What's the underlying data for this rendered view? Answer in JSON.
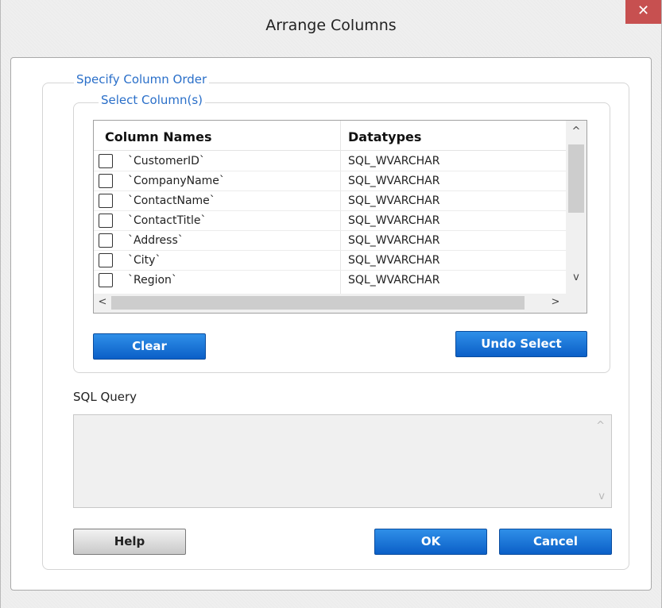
{
  "window": {
    "title": "Arrange Columns",
    "close_glyph": "✕"
  },
  "groups": {
    "outer_legend": "Specify Column Order",
    "inner_legend": "Select Column(s)"
  },
  "grid": {
    "headers": [
      "Column Names",
      "Datatypes"
    ],
    "rows": [
      {
        "name": "`CustomerID`",
        "type": "SQL_WVARCHAR",
        "checked": false
      },
      {
        "name": "`CompanyName`",
        "type": "SQL_WVARCHAR",
        "checked": false
      },
      {
        "name": "`ContactName`",
        "type": "SQL_WVARCHAR",
        "checked": false
      },
      {
        "name": "`ContactTitle`",
        "type": "SQL_WVARCHAR",
        "checked": false
      },
      {
        "name": "`Address`",
        "type": "SQL_WVARCHAR",
        "checked": false
      },
      {
        "name": "`City`",
        "type": "SQL_WVARCHAR",
        "checked": false
      },
      {
        "name": "`Region`",
        "type": "SQL_WVARCHAR",
        "checked": false
      }
    ],
    "arrows": {
      "up": "^",
      "down": "v",
      "left": "<",
      "right": ">"
    }
  },
  "buttons": {
    "clear": "Clear",
    "undo_select": "Undo Select",
    "help": "Help",
    "ok": "OK",
    "cancel": "Cancel"
  },
  "sql": {
    "label": "SQL Query",
    "value": ""
  },
  "colors": {
    "accent_blue": "#0b5fc7",
    "legend_blue": "#2a6fc9",
    "close_red": "#c75050"
  }
}
